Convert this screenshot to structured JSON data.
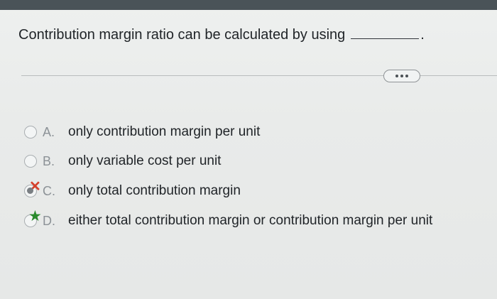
{
  "question": {
    "text": "Contribution margin ratio can be calculated by using",
    "period": "."
  },
  "more_button": {
    "icon": "ellipsis-icon"
  },
  "options": [
    {
      "letter": "A.",
      "text": "only contribution margin per unit",
      "state": "unselected"
    },
    {
      "letter": "B.",
      "text": "only variable cost per unit",
      "state": "unselected"
    },
    {
      "letter": "C.",
      "text": "only total contribution margin",
      "state": "selected-incorrect",
      "marker_icon": "red-x-icon"
    },
    {
      "letter": "D.",
      "text": "either total contribution margin or contribution margin per unit",
      "state": "correct-answer",
      "marker_icon": "green-star-icon"
    }
  ],
  "colors": {
    "incorrect_mark": "#d5402b",
    "correct_mark": "#2a8a2c",
    "top_bar": "#4a5358"
  }
}
